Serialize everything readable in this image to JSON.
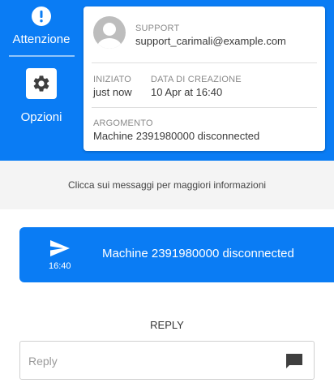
{
  "sidebar": {
    "alert_label": "Attenzione",
    "options_label": "Opzioni"
  },
  "ticket": {
    "support_caption": "SUPPORT",
    "support_email": "support_carimali@example.com",
    "started_caption": "INIZIATO",
    "started_value": "just now",
    "created_caption": "DATA DI CREAZIONE",
    "created_value": "10 Apr at 16:40",
    "subject_caption": "ARGOMENTO",
    "subject_value": "Machine 2391980000 disconnected"
  },
  "hint": "Clicca sui messaggi per maggiori informazioni",
  "messages": [
    {
      "time": "16:40",
      "text": "Machine 2391980000 disconnected",
      "icon": "send-icon"
    }
  ],
  "reply": {
    "label": "REPLY",
    "placeholder": "Reply"
  },
  "colors": {
    "primary": "#0a7cf4",
    "hint_background": "#f4f4f4",
    "icon_dark": "#3f3f3f"
  }
}
